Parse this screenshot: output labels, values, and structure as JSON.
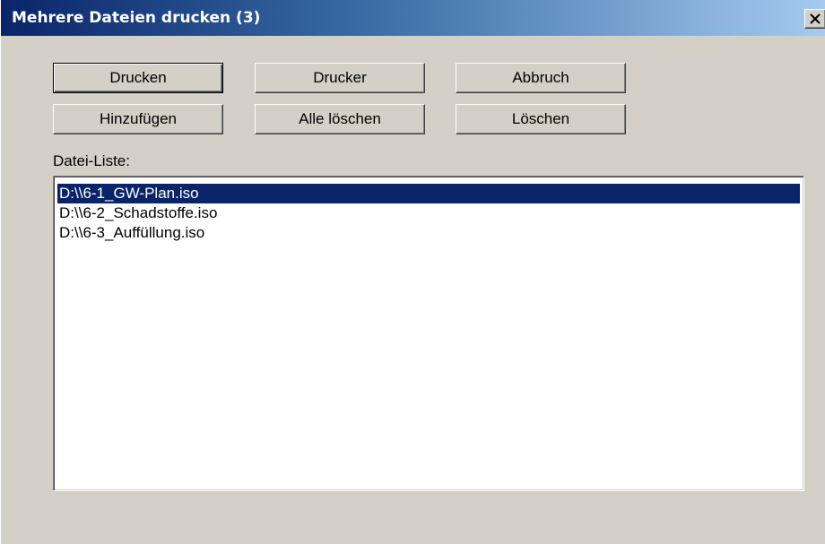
{
  "window": {
    "title": "Mehrere Dateien drucken (3)"
  },
  "buttons": {
    "print": "Drucken",
    "printer": "Drucker",
    "cancel": "Abbruch",
    "add": "Hinzufügen",
    "delete_all": "Alle löschen",
    "delete": "Löschen"
  },
  "file_list": {
    "label": "Datei-Liste:",
    "items": [
      "D:\\\\6-1_GW-Plan.iso",
      "D:\\\\6-2_Schadstoffe.iso",
      "D:\\\\6-3_Auffüllung.iso"
    ],
    "selected_index": 0
  },
  "colors": {
    "title_gradient_start": "#0a246a",
    "title_gradient_end": "#a6caf0",
    "dialog_background": "#d4d0c8",
    "selection_background": "#0a246a"
  },
  "icons": {
    "close": "close-icon"
  }
}
